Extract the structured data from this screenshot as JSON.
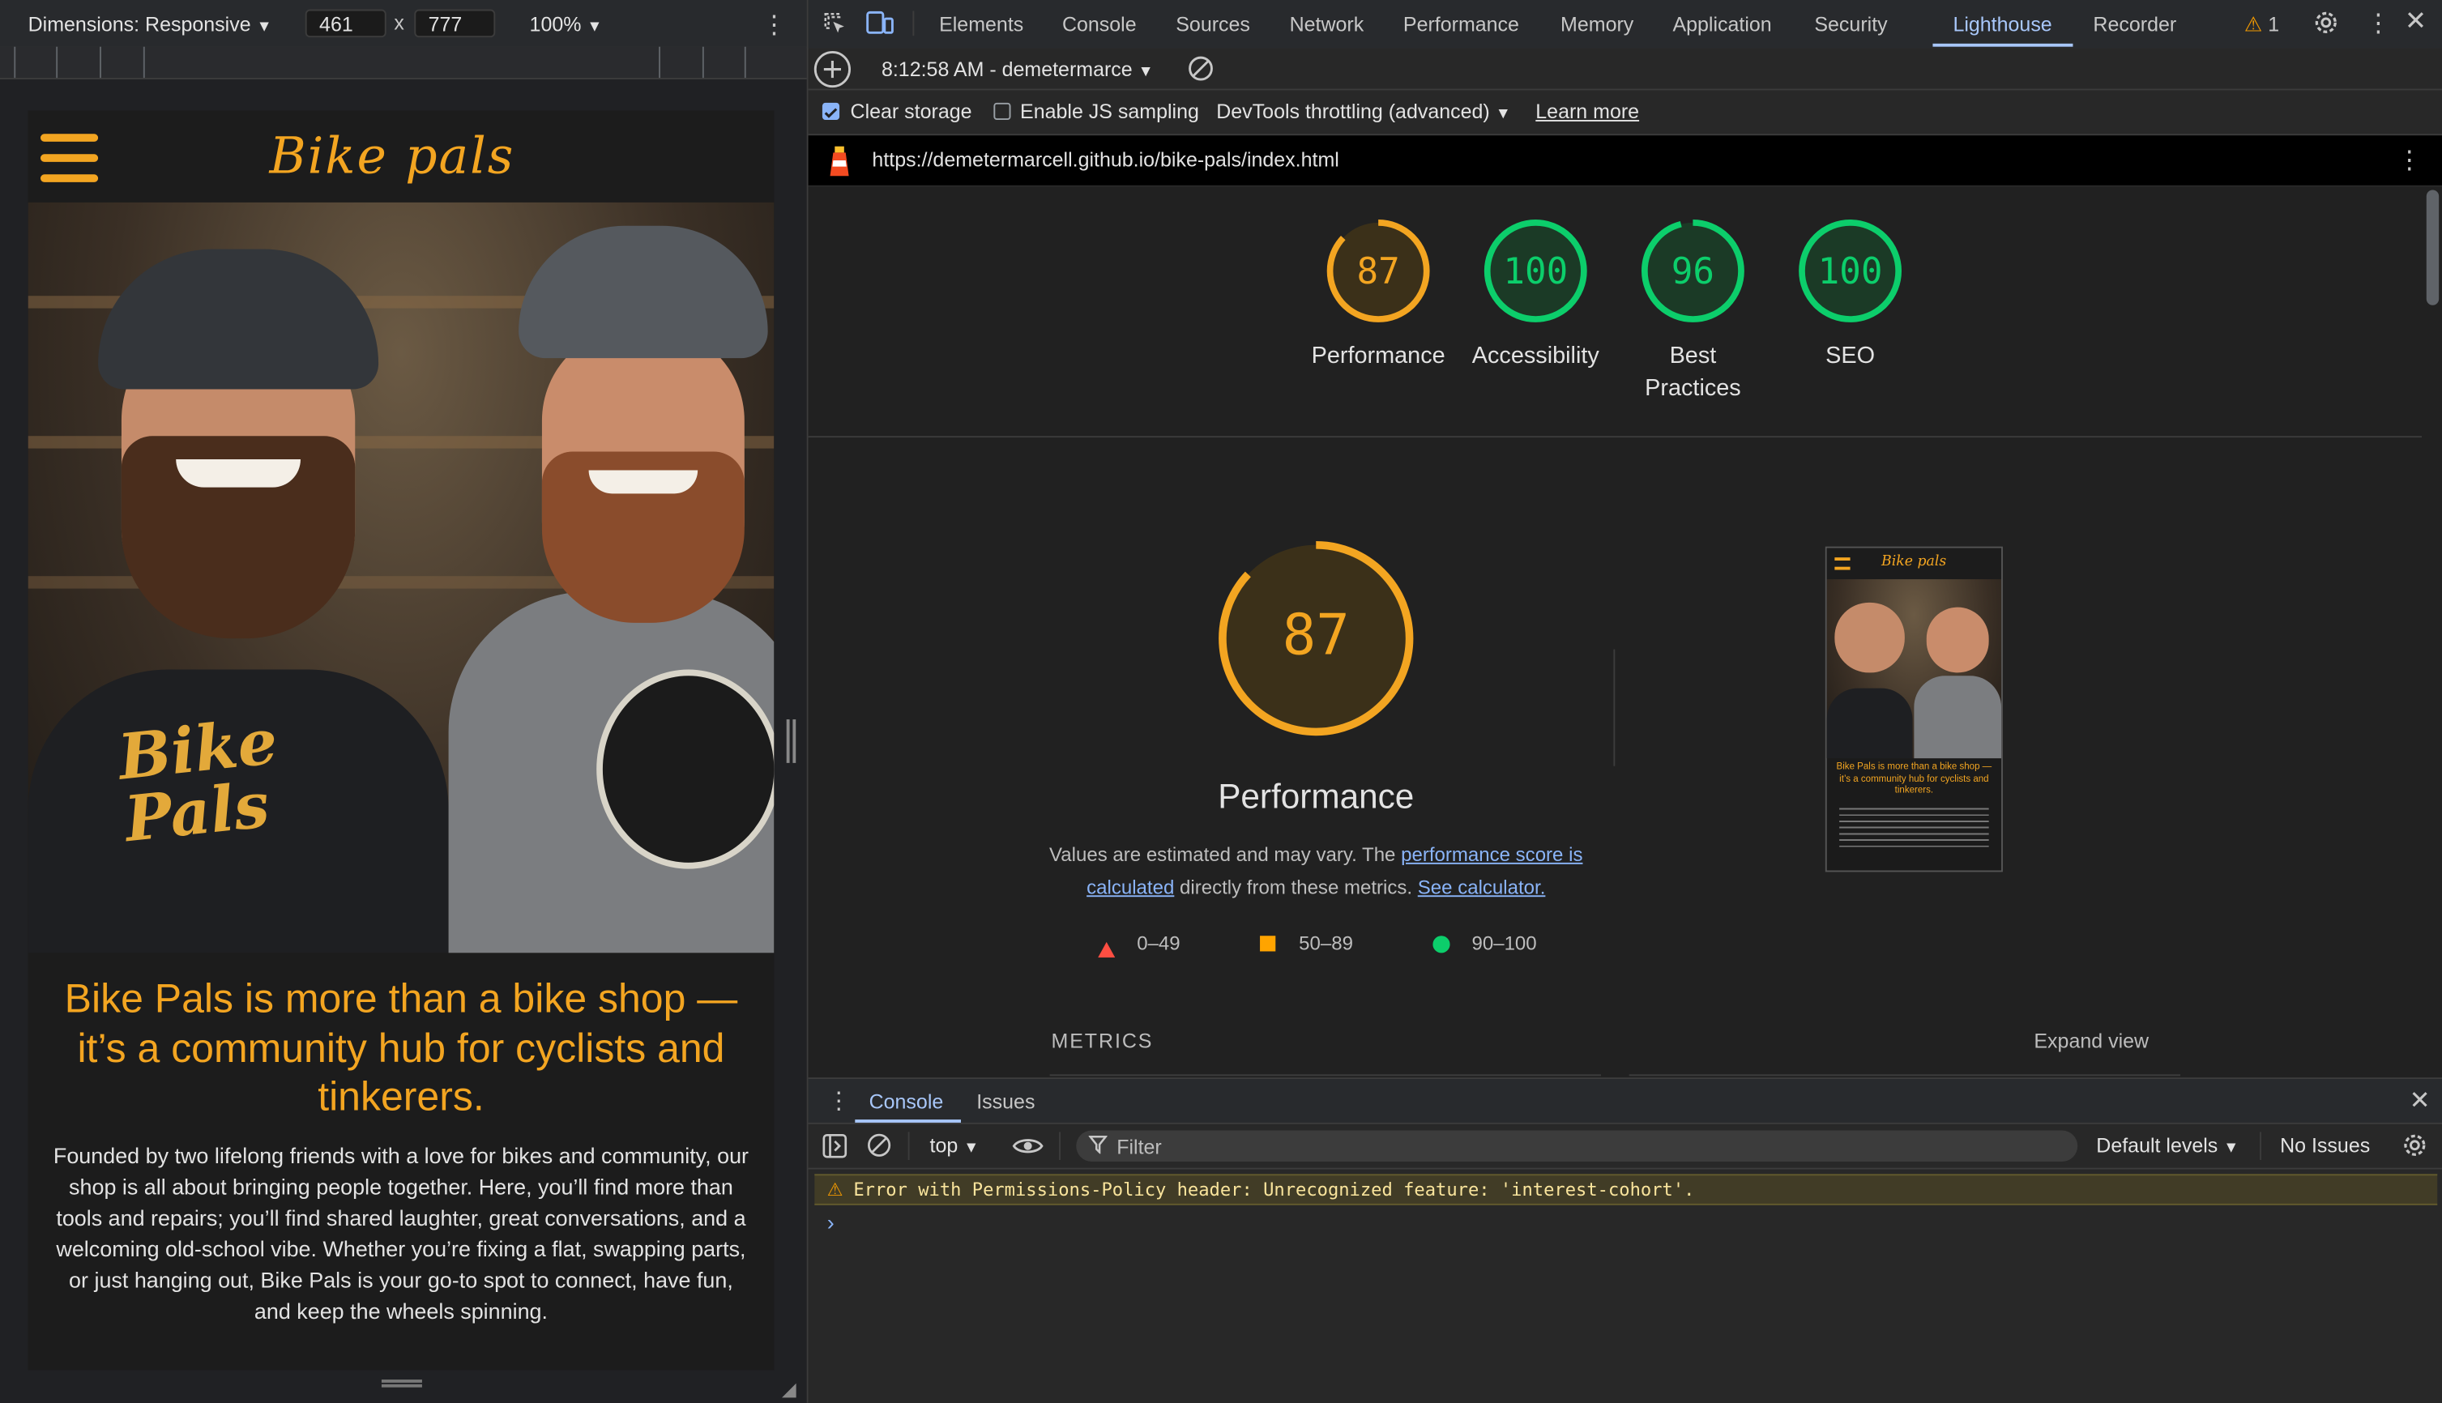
{
  "device_toolbar": {
    "dimensions_label": "Dimensions: Responsive",
    "width_value": "461",
    "times": "x",
    "height_value": "777",
    "zoom": "100%"
  },
  "site": {
    "logo": "Bike pals",
    "hero_shirt_text_1": "Bike",
    "hero_shirt_text_2": "Pals",
    "heading": "Bike Pals is more than a bike shop — it’s a community hub for cyclists and tinkerers.",
    "paragraph": "Founded by two lifelong friends with a love for bikes and community, our shop is all about bringing people together. Here, you’ll find more than tools and repairs; you’ll find shared laughter, great conversations, and a welcoming old-school vibe. Whether you’re fixing a flat, swapping parts, or just hanging out, Bike Pals is your go-to spot to connect, have fun, and keep the wheels spinning."
  },
  "devtools": {
    "tabs": [
      "Elements",
      "Console",
      "Sources",
      "Network",
      "Performance",
      "Memory",
      "Application",
      "Security",
      "Lighthouse",
      "Recorder"
    ],
    "active_tab": "Lighthouse",
    "warning_count": "1",
    "lighthouse": {
      "report_selector": "8:12:58 AM - demetermarce",
      "clear_storage_label": "Clear storage",
      "clear_storage_checked": true,
      "js_sampling_label": "Enable JS sampling",
      "js_sampling_checked": false,
      "throttling_label": "DevTools throttling (advanced)",
      "learn_more": "Learn more",
      "url": "https://demetermarcell.github.io/bike-pals/index.html",
      "gauges": [
        {
          "label": "Performance",
          "score": "87",
          "value": 87,
          "color": "#f3a521",
          "fill": "#3b3019"
        },
        {
          "label": "Accessibility",
          "score": "100",
          "value": 100,
          "color": "#0cce6b",
          "fill": "#1b3a26"
        },
        {
          "label": "Best Practices",
          "score": "96",
          "value": 96,
          "color": "#0cce6b",
          "fill": "#1b3a26"
        },
        {
          "label": "SEO",
          "score": "100",
          "value": 100,
          "color": "#0cce6b",
          "fill": "#1b3a26"
        }
      ],
      "main_gauge": {
        "score": "87",
        "value": 87,
        "title": "Performance"
      },
      "desc_prefix": "Values are estimated and may vary. The ",
      "desc_link1": "performance score is calculated",
      "desc_middle": " directly from these metrics. ",
      "desc_link2": "See calculator.",
      "legend": [
        {
          "range": "0–49",
          "color": "#ff4e42"
        },
        {
          "range": "50–89",
          "color": "#ffa400"
        },
        {
          "range": "90–100",
          "color": "#0cce6b"
        }
      ],
      "metrics_label": "METRICS",
      "expand_view": "Expand view",
      "thumb_logo": "Bike pals",
      "thumb_heading": "Bike Pals is more than a bike shop — it’s a community hub for cyclists and tinkerers."
    },
    "drawer": {
      "tabs": [
        "Console",
        "Issues"
      ],
      "context": "top",
      "filter_placeholder": "Filter",
      "levels": "Default levels",
      "issues": "No Issues",
      "message": "Error with Permissions-Policy header: Unrecognized feature: 'interest-cohort'.",
      "prompt": "›"
    }
  },
  "colors": {
    "accent_orange": "#f3a521",
    "pass_green": "#0cce6b",
    "tab_active": "#a8c7fa"
  }
}
